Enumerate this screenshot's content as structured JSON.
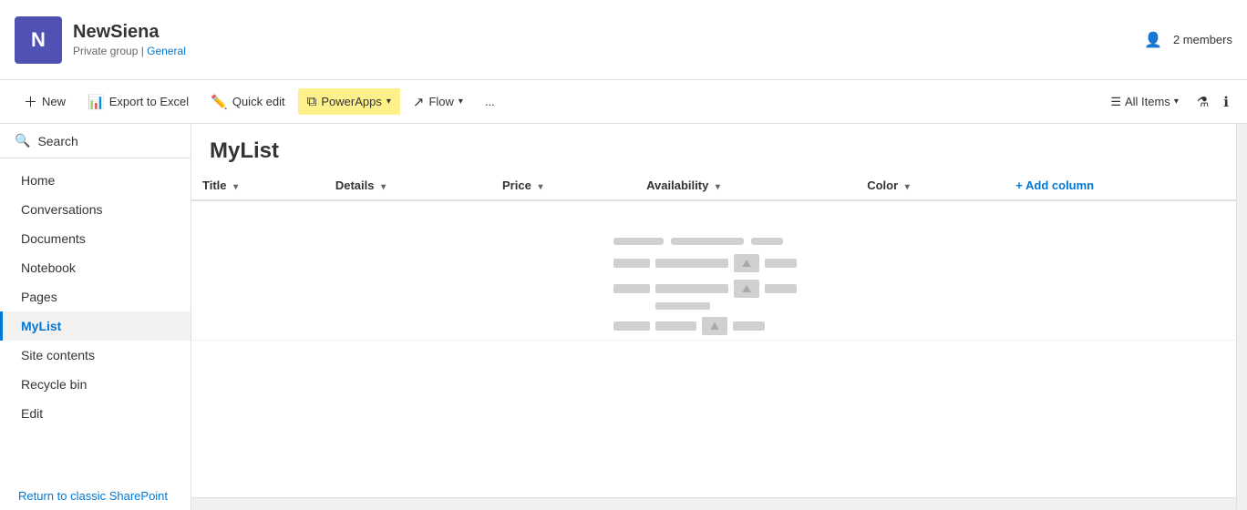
{
  "header": {
    "site_icon_letter": "N",
    "site_name": "NewSiena",
    "site_meta": "Private group | General",
    "meta_link": "General",
    "members_label": "2 members"
  },
  "toolbar": {
    "new_label": "New",
    "export_label": "Export to Excel",
    "quick_edit_label": "Quick edit",
    "powerapps_label": "PowerApps",
    "flow_label": "Flow",
    "more_label": "...",
    "all_items_label": "All Items"
  },
  "sidebar": {
    "search_label": "Search",
    "nav_items": [
      {
        "id": "home",
        "label": "Home",
        "active": false
      },
      {
        "id": "conversations",
        "label": "Conversations",
        "active": false
      },
      {
        "id": "documents",
        "label": "Documents",
        "active": false
      },
      {
        "id": "notebook",
        "label": "Notebook",
        "active": false
      },
      {
        "id": "pages",
        "label": "Pages",
        "active": false
      },
      {
        "id": "mylist",
        "label": "MyList",
        "active": true
      },
      {
        "id": "site-contents",
        "label": "Site contents",
        "active": false
      },
      {
        "id": "recycle-bin",
        "label": "Recycle bin",
        "active": false
      },
      {
        "id": "edit",
        "label": "Edit",
        "active": false
      }
    ],
    "footer_link": "Return to classic SharePoint"
  },
  "content": {
    "list_title": "MyList",
    "columns": [
      {
        "label": "Title"
      },
      {
        "label": "Details"
      },
      {
        "label": "Price"
      },
      {
        "label": "Availability"
      },
      {
        "label": "Color"
      }
    ],
    "add_column_label": "+ Add column"
  }
}
